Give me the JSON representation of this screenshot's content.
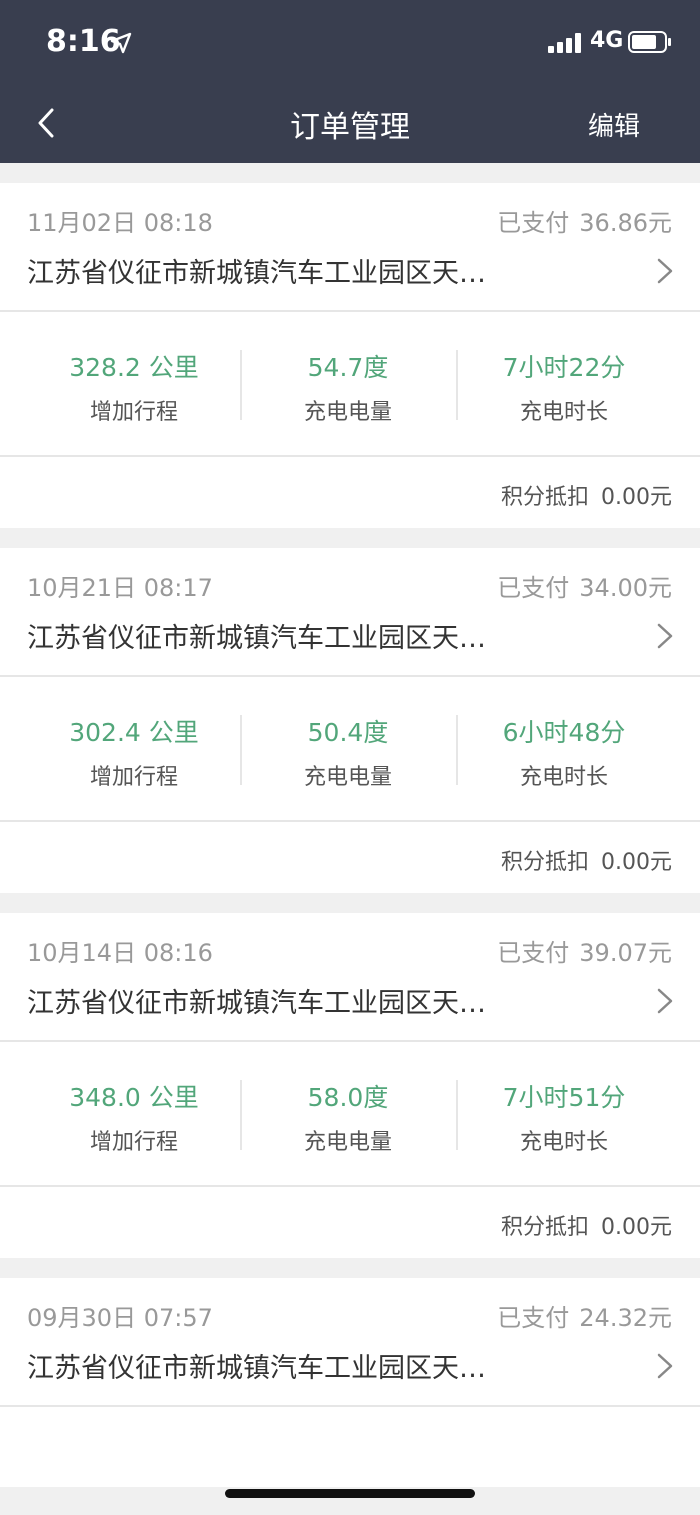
{
  "status": {
    "time": "8:16",
    "network": "4G"
  },
  "nav": {
    "title": "订单管理",
    "edit_label": "编辑"
  },
  "orders": [
    {
      "date": "11月02日 08:18",
      "paid_label": "已支付",
      "amount": "36.86元",
      "address": "江苏省仪征市新城镇汽车工业园区天…",
      "stats": [
        {
          "value": "328.2 公里",
          "label": "增加行程"
        },
        {
          "value": "54.7度",
          "label": "充电电量"
        },
        {
          "value": "7小时22分",
          "label": "充电时长"
        }
      ],
      "credit_label": "积分抵扣",
      "credit_value": "0.00元"
    },
    {
      "date": "10月21日 08:17",
      "paid_label": "已支付",
      "amount": "34.00元",
      "address": "江苏省仪征市新城镇汽车工业园区天…",
      "stats": [
        {
          "value": "302.4 公里",
          "label": "增加行程"
        },
        {
          "value": "50.4度",
          "label": "充电电量"
        },
        {
          "value": "6小时48分",
          "label": "充电时长"
        }
      ],
      "credit_label": "积分抵扣",
      "credit_value": "0.00元"
    },
    {
      "date": "10月14日 08:16",
      "paid_label": "已支付",
      "amount": "39.07元",
      "address": "江苏省仪征市新城镇汽车工业园区天…",
      "stats": [
        {
          "value": "348.0 公里",
          "label": "增加行程"
        },
        {
          "value": "58.0度",
          "label": "充电电量"
        },
        {
          "value": "7小时51分",
          "label": "充电时长"
        }
      ],
      "credit_label": "积分抵扣",
      "credit_value": "0.00元"
    },
    {
      "date": "09月30日 07:57",
      "paid_label": "已支付",
      "amount": "24.32元",
      "address": "江苏省仪征市新城镇汽车工业园区天…"
    }
  ],
  "colors": {
    "header_bg": "#393e4f",
    "stat_green": "#52a67a",
    "page_bg": "#f0f0f0"
  }
}
